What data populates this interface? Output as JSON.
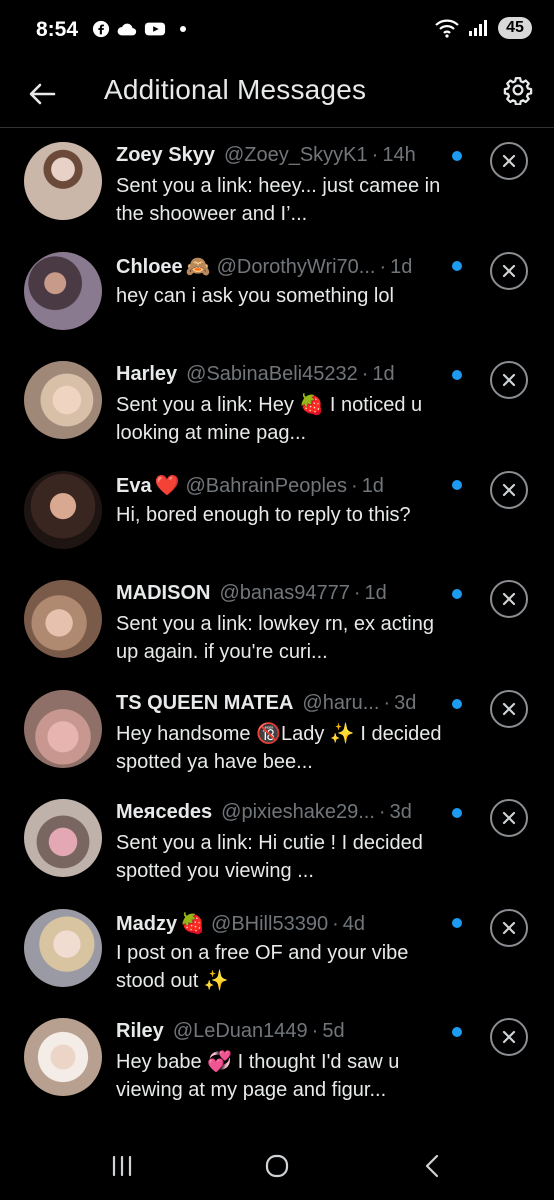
{
  "status_bar": {
    "time": "8:54",
    "battery": "45"
  },
  "header": {
    "title": "Additional Messages"
  },
  "colors": {
    "background": "#000000",
    "text": "#e7e9ea",
    "muted": "#71767b",
    "unread_dot": "#1d9bf0",
    "divider": "#2f3336"
  },
  "messages": [
    {
      "name": "Zoey Skyy",
      "emoji": "",
      "handle": "@Zoey_SkyyK1",
      "time": "14h",
      "preview": "Sent you a link: heey... just camee in the shooweer and I’..."
    },
    {
      "name": "Chloee",
      "emoji": "🙈",
      "handle": "@DorothyWri70...",
      "time": "1d",
      "preview": "hey can i ask you something lol"
    },
    {
      "name": "Harley",
      "emoji": "",
      "handle": "@SabinaBeli45232",
      "time": "1d",
      "preview": "Sent you a link: Hey 🍓 I noticed u looking at mine pag..."
    },
    {
      "name": "Eva",
      "emoji": "❤️",
      "handle": "@BahrainPeoples",
      "time": "1d",
      "preview": "Hi, bored enough to reply to this?"
    },
    {
      "name": "MADISON",
      "emoji": "",
      "handle": "@banas94777",
      "time": "1d",
      "preview": "Sent you a link: lowkey rn, ex acting up again. if you're curi..."
    },
    {
      "name": "TS QUEEN MATEA",
      "emoji": "",
      "handle": "@haru...",
      "time": "3d",
      "preview": "Hey handsome 🔞Lady ✨ I decided spotted ya have bee..."
    },
    {
      "name": "Meяcedes",
      "emoji": "",
      "handle": "@pixieshake29...",
      "time": "3d",
      "preview": "Sent you a link: Hi cutie ! I decided spotted you viewing ..."
    },
    {
      "name": "Madzy",
      "emoji": "🍓",
      "handle": "@BHill53390",
      "time": "4d",
      "preview": "I post on a free OF and your vibe stood out ✨"
    },
    {
      "name": "Riley",
      "emoji": "",
      "handle": "@LeDuan1449",
      "time": "5d",
      "preview": "Hey babe 💞 I thought I'd saw u viewing at my page and figur..."
    }
  ]
}
